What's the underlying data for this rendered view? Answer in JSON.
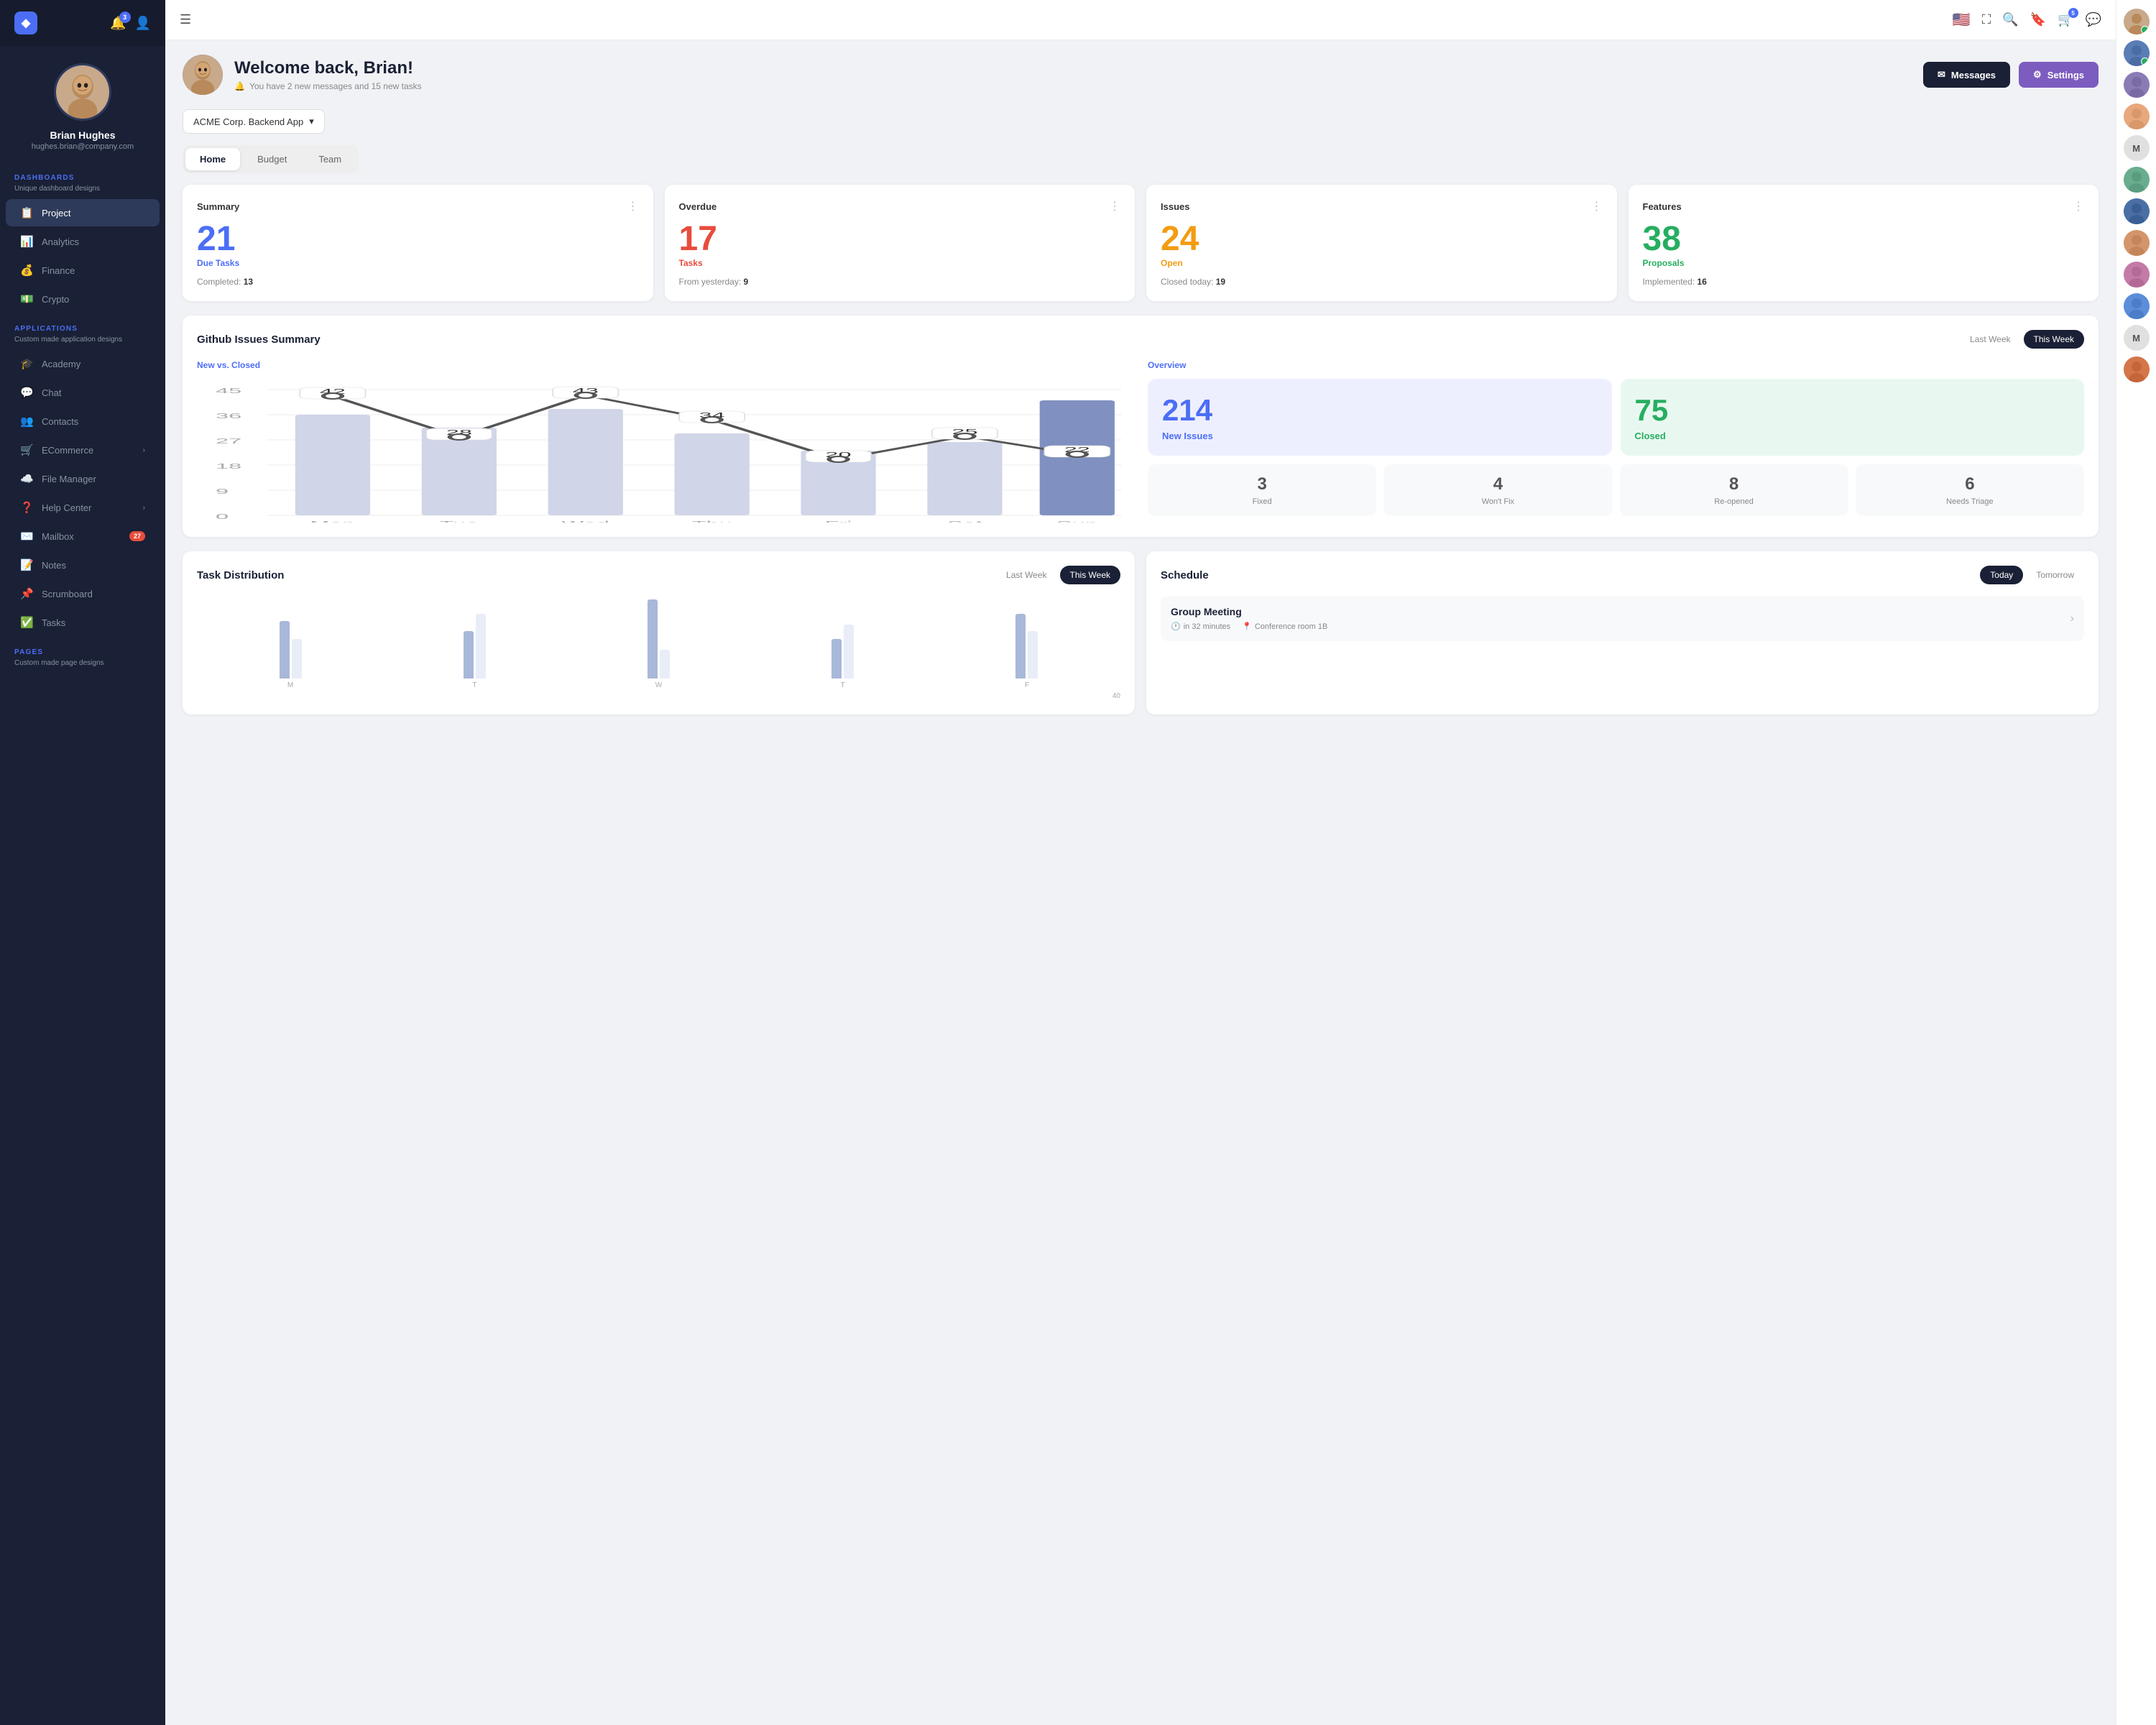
{
  "sidebar": {
    "logo": "◆",
    "notification_badge": "3",
    "profile": {
      "name": "Brian Hughes",
      "email": "hughes.brian@company.com"
    },
    "dashboards_label": "DASHBOARDS",
    "dashboards_sublabel": "Unique dashboard designs",
    "nav_items_dashboards": [
      {
        "id": "project",
        "label": "Project",
        "icon": "📋",
        "active": true
      },
      {
        "id": "analytics",
        "label": "Analytics",
        "icon": "📊"
      },
      {
        "id": "finance",
        "label": "Finance",
        "icon": "💰"
      },
      {
        "id": "crypto",
        "label": "Crypto",
        "icon": "💵"
      }
    ],
    "applications_label": "APPLICATIONS",
    "applications_sublabel": "Custom made application designs",
    "nav_items_apps": [
      {
        "id": "academy",
        "label": "Academy",
        "icon": "🎓"
      },
      {
        "id": "chat",
        "label": "Chat",
        "icon": "💬"
      },
      {
        "id": "contacts",
        "label": "Contacts",
        "icon": "👥"
      },
      {
        "id": "ecommerce",
        "label": "ECommerce",
        "icon": "🛒",
        "has_arrow": true
      },
      {
        "id": "file-manager",
        "label": "File Manager",
        "icon": "☁️"
      },
      {
        "id": "help-center",
        "label": "Help Center",
        "icon": "❓",
        "has_arrow": true
      },
      {
        "id": "mailbox",
        "label": "Mailbox",
        "icon": "✉️",
        "badge": "27"
      },
      {
        "id": "notes",
        "label": "Notes",
        "icon": "📝"
      },
      {
        "id": "scrumboard",
        "label": "Scrumboard",
        "icon": "📌"
      },
      {
        "id": "tasks",
        "label": "Tasks",
        "icon": "✅"
      }
    ],
    "pages_label": "PAGES",
    "pages_sublabel": "Custom made page designs"
  },
  "topbar": {
    "menu_icon": "☰",
    "flag": "🇺🇸",
    "search_icon": "🔍",
    "bookmark_icon": "🔖",
    "cart_icon": "🛒",
    "cart_badge": "5",
    "chat_icon": "💬"
  },
  "welcome": {
    "title": "Welcome back, Brian!",
    "subtitle": "You have 2 new messages and 15 new tasks",
    "bell_icon": "🔔",
    "btn_messages": "Messages",
    "btn_settings": "Settings",
    "envelope_icon": "✉",
    "gear_icon": "⚙"
  },
  "project_selector": {
    "label": "ACME Corp. Backend App",
    "arrow": "▾"
  },
  "tabs": [
    {
      "id": "home",
      "label": "Home",
      "active": true
    },
    {
      "id": "budget",
      "label": "Budget"
    },
    {
      "id": "team",
      "label": "Team"
    }
  ],
  "stats": [
    {
      "id": "summary",
      "title": "Summary",
      "number": "21",
      "sublabel": "Due Tasks",
      "color": "blue",
      "footer_text": "Completed:",
      "footer_val": "13"
    },
    {
      "id": "overdue",
      "title": "Overdue",
      "number": "17",
      "sublabel": "Tasks",
      "color": "red",
      "footer_text": "From yesterday:",
      "footer_val": "9"
    },
    {
      "id": "issues",
      "title": "Issues",
      "number": "24",
      "sublabel": "Open",
      "color": "orange",
      "footer_text": "Closed today:",
      "footer_val": "19"
    },
    {
      "id": "features",
      "title": "Features",
      "number": "38",
      "sublabel": "Proposals",
      "color": "green",
      "footer_text": "Implemented:",
      "footer_val": "16"
    }
  ],
  "github": {
    "title": "Github Issues Summary",
    "last_week_label": "Last Week",
    "this_week_label": "This Week",
    "chart_label": "New vs. Closed",
    "overview_label": "Overview",
    "chart_data": {
      "days": [
        "Mon",
        "Tue",
        "Wed",
        "Thu",
        "Fri",
        "Sat",
        "Sun"
      ],
      "line_values": [
        42,
        28,
        43,
        34,
        20,
        25,
        22
      ],
      "bar_values": [
        35,
        30,
        38,
        27,
        18,
        22,
        40
      ]
    },
    "new_issues": "214",
    "new_issues_label": "New Issues",
    "closed": "75",
    "closed_label": "Closed",
    "mini_stats": [
      {
        "id": "fixed",
        "number": "3",
        "label": "Fixed"
      },
      {
        "id": "wont-fix",
        "number": "4",
        "label": "Won't Fix"
      },
      {
        "id": "reopened",
        "number": "8",
        "label": "Re-opened"
      },
      {
        "id": "triage",
        "number": "6",
        "label": "Needs Triage"
      }
    ]
  },
  "task_distribution": {
    "title": "Task Distribution",
    "last_week_label": "Last Week",
    "this_week_label": "This Week",
    "y_max": 40,
    "bars": [
      {
        "day": "M",
        "v1": 30,
        "v2": 20
      },
      {
        "day": "T",
        "v1": 25,
        "v2": 35
      },
      {
        "day": "W",
        "v1": 40,
        "v2": 15
      },
      {
        "day": "T",
        "v1": 20,
        "v2": 30
      },
      {
        "day": "F",
        "v1": 35,
        "v2": 25
      }
    ]
  },
  "schedule": {
    "title": "Schedule",
    "today_label": "Today",
    "tomorrow_label": "Tomorrow",
    "meeting_title": "Group Meeting",
    "meeting_time": "in 32 minutes",
    "meeting_location": "Conference room 1B"
  },
  "right_sidebar": {
    "avatars": [
      {
        "id": "rs1",
        "bg": "#c8a98a",
        "online": true
      },
      {
        "id": "rs2",
        "bg": "#5a7db5",
        "online": true
      },
      {
        "id": "rs3",
        "bg": "#8b7bb5",
        "online": false
      },
      {
        "id": "rs4",
        "bg": "#e8a87c",
        "online": false
      },
      {
        "id": "rs5",
        "bg": "#6aad8e",
        "online": false
      },
      {
        "id": "rs6",
        "bg": "#4a6fa5",
        "online": false
      },
      {
        "id": "rs7",
        "bg": "#d4956a",
        "online": false
      },
      {
        "id": "rs8",
        "bg": "#c47aa7",
        "online": false
      },
      {
        "id": "rs9",
        "bg": "#5b8dd9",
        "online": false
      },
      {
        "id": "m1",
        "initial": "M",
        "online": false
      },
      {
        "id": "rs10",
        "bg": "#d4764a",
        "online": false
      },
      {
        "id": "m2",
        "initial": "M",
        "online": false
      }
    ]
  }
}
